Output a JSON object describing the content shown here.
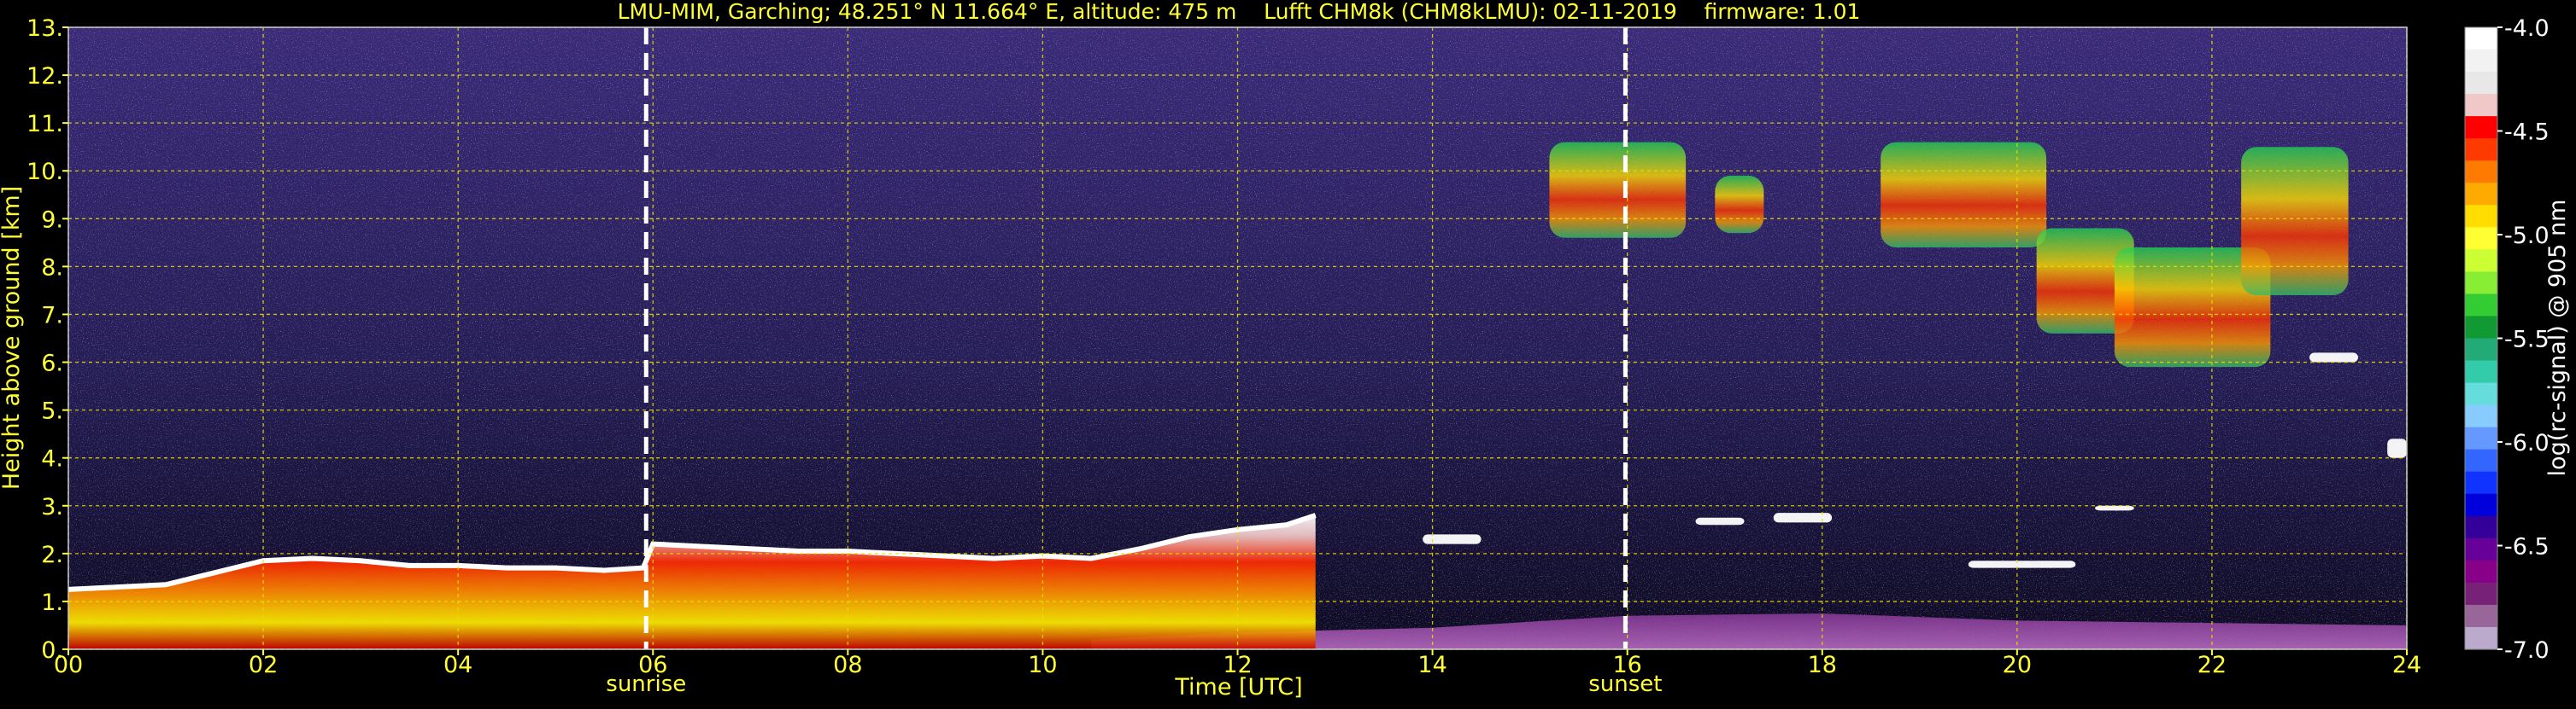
{
  "chart_data": {
    "type": "heatmap",
    "title": "LMU-MIM, Garching; 48.251° N 11.664° E, altitude: 475 m    Lufft CHM8k (CHM8kLMU): 02-11-2019    firmware: 1.01",
    "xlabel": "Time [UTC]",
    "ylabel": "Height above ground [km]",
    "xlim": [
      0,
      24
    ],
    "ylim": [
      0,
      13
    ],
    "x_ticks": [
      0,
      2,
      4,
      6,
      8,
      10,
      12,
      14,
      16,
      18,
      20,
      22,
      24
    ],
    "x_tick_labels": [
      "00",
      "02",
      "04",
      "06",
      "08",
      "10",
      "12",
      "14",
      "16",
      "18",
      "20",
      "22",
      "24"
    ],
    "y_ticks": [
      0,
      1,
      2,
      3,
      4,
      5,
      6,
      7,
      8,
      9,
      10,
      11,
      12,
      13
    ],
    "y_tick_labels": [
      "0.",
      "1.",
      "2.",
      "3.",
      "4.",
      "5.",
      "6.",
      "7.",
      "8.",
      "9.",
      "10.",
      "11.",
      "12.",
      "13."
    ],
    "grid": true,
    "markers": [
      {
        "label": "sunrise",
        "time": 5.93
      },
      {
        "label": "sunset",
        "time": 15.98
      }
    ],
    "colorbar": {
      "label": "log(rc-signal) @ 905 nm",
      "range": [
        -7.0,
        -4.0
      ],
      "ticks": [
        -4.0,
        -4.5,
        -5.0,
        -5.5,
        -6.0,
        -6.5,
        -7.0
      ],
      "tick_labels": [
        "-4.0",
        "-4.5",
        "-5.0",
        "-5.5",
        "-6.0",
        "-6.5",
        "-7.0"
      ],
      "colors_top_to_bottom": [
        "#ffffff",
        "#f2f2f2",
        "#e8e8e8",
        "#f0c8c8",
        "#ff0000",
        "#ff3a00",
        "#ff7a00",
        "#ffaa00",
        "#ffdd00",
        "#ffff33",
        "#ccff33",
        "#88ee33",
        "#33cc33",
        "#119933",
        "#22aa77",
        "#33ccaa",
        "#66dddd",
        "#88ccff",
        "#6699ff",
        "#3366ff",
        "#1133ff",
        "#0000dd",
        "#330099",
        "#660099",
        "#880088",
        "#772277",
        "#996699",
        "#bbaacc"
      ]
    },
    "boundary_layer_top_km": [
      [
        0.0,
        1.25
      ],
      [
        0.5,
        1.3
      ],
      [
        1.0,
        1.35
      ],
      [
        1.5,
        1.6
      ],
      [
        2.0,
        1.85
      ],
      [
        2.5,
        1.9
      ],
      [
        3.0,
        1.85
      ],
      [
        3.5,
        1.75
      ],
      [
        4.0,
        1.75
      ],
      [
        4.5,
        1.7
      ],
      [
        5.0,
        1.7
      ],
      [
        5.5,
        1.65
      ],
      [
        5.9,
        1.7
      ],
      [
        6.0,
        2.2
      ],
      [
        6.5,
        2.15
      ],
      [
        7.0,
        2.1
      ],
      [
        7.5,
        2.05
      ],
      [
        8.0,
        2.05
      ],
      [
        8.5,
        2.0
      ],
      [
        9.0,
        1.95
      ],
      [
        9.5,
        1.9
      ],
      [
        10.0,
        1.95
      ],
      [
        10.5,
        1.9
      ],
      [
        11.0,
        2.1
      ],
      [
        11.5,
        2.35
      ],
      [
        12.0,
        2.5
      ],
      [
        12.5,
        2.6
      ],
      [
        12.8,
        2.8
      ]
    ],
    "cloud_features": [
      {
        "t0": 15.2,
        "t1": 16.6,
        "h0": 8.6,
        "h1": 10.6
      },
      {
        "t0": 16.9,
        "t1": 17.4,
        "h0": 8.7,
        "h1": 9.9
      },
      {
        "t0": 18.6,
        "t1": 20.3,
        "h0": 8.4,
        "h1": 10.6
      },
      {
        "t0": 20.2,
        "t1": 21.2,
        "h0": 6.6,
        "h1": 8.8
      },
      {
        "t0": 21.0,
        "t1": 22.6,
        "h0": 5.9,
        "h1": 8.4
      },
      {
        "t0": 22.3,
        "t1": 23.4,
        "h0": 7.4,
        "h1": 10.5
      },
      {
        "t0": 16.7,
        "t1": 17.2,
        "h0": 2.6,
        "h1": 2.75
      },
      {
        "t0": 17.5,
        "t1": 18.1,
        "h0": 2.65,
        "h1": 2.85
      },
      {
        "t0": 19.5,
        "t1": 20.6,
        "h0": 1.7,
        "h1": 1.85
      },
      {
        "t0": 20.8,
        "t1": 21.2,
        "h0": 2.9,
        "h1": 3.0
      },
      {
        "t0": 13.9,
        "t1": 14.5,
        "h0": 2.2,
        "h1": 2.4
      },
      {
        "t0": 23.0,
        "t1": 23.5,
        "h0": 6.0,
        "h1": 6.2
      },
      {
        "t0": 23.8,
        "t1": 24.0,
        "h0": 4.0,
        "h1": 4.4
      }
    ]
  }
}
